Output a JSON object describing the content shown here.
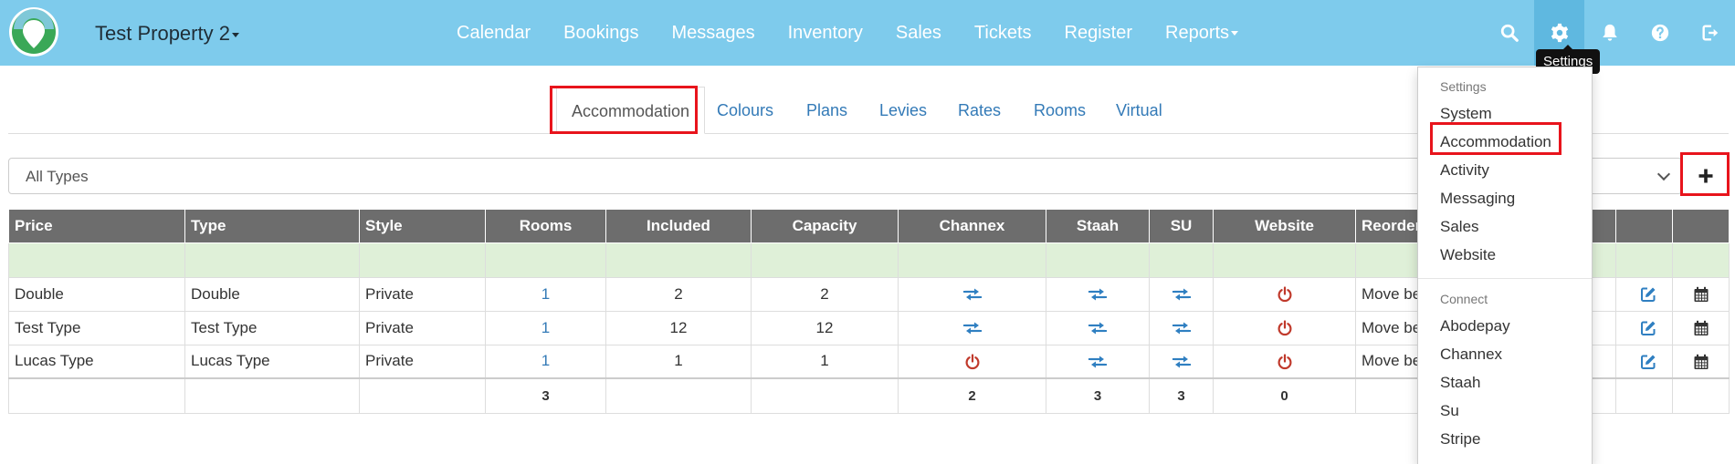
{
  "colors": {
    "navbar": "#7ecbec",
    "link": "#337ab7",
    "header_bg": "#6d6d6d",
    "highlight": "#e8141c",
    "sync_icon": "#2f7fc1",
    "power_icon": "#c0392b",
    "empty_row": "#dff0d8"
  },
  "header": {
    "property_name": "Test Property 2",
    "nav": [
      "Calendar",
      "Bookings",
      "Messages",
      "Inventory",
      "Sales",
      "Tickets",
      "Register",
      "Reports"
    ],
    "icons": [
      "search-icon",
      "gear-icon",
      "bell-icon",
      "help-icon",
      "logout-icon"
    ],
    "tooltip": "Settings"
  },
  "tabs": {
    "active": "Accommodation",
    "items": [
      "Colours",
      "Plans",
      "Levies",
      "Rates",
      "Rooms",
      "Virtual"
    ]
  },
  "filter": {
    "selected": "All Types"
  },
  "table": {
    "columns": [
      "Price",
      "Type",
      "Style",
      "Rooms",
      "Included",
      "Capacity",
      "Channex",
      "Staah",
      "SU",
      "Website",
      "Reorder"
    ],
    "rows": [
      {
        "price": "Double",
        "type": "Double",
        "style": "Private",
        "rooms": "1",
        "included": "2",
        "capacity": "2",
        "channex": "sync-icon",
        "staah": "sync-icon",
        "su": "sync-icon",
        "website": "power-icon",
        "reorder": "Move be"
      },
      {
        "price": "Test Type",
        "type": "Test Type",
        "style": "Private",
        "rooms": "1",
        "included": "12",
        "capacity": "12",
        "channex": "sync-icon",
        "staah": "sync-icon",
        "su": "sync-icon",
        "website": "power-icon",
        "reorder": "Move be"
      },
      {
        "price": "Lucas Type",
        "type": "Lucas Type",
        "style": "Private",
        "rooms": "1",
        "included": "1",
        "capacity": "1",
        "channex": "power-icon",
        "staah": "sync-icon",
        "su": "sync-icon",
        "website": "power-icon",
        "reorder": "Move be"
      }
    ],
    "totals": {
      "rooms": "3",
      "channex": "2",
      "staah": "3",
      "su": "3",
      "website": "0"
    }
  },
  "menu": {
    "settings_header": "Settings",
    "settings_items": [
      "System",
      "Accommodation",
      "Activity",
      "Messaging",
      "Sales",
      "Website"
    ],
    "connect_header": "Connect",
    "connect_items": [
      "Abodepay",
      "Channex",
      "Staah",
      "Su",
      "Stripe"
    ]
  }
}
